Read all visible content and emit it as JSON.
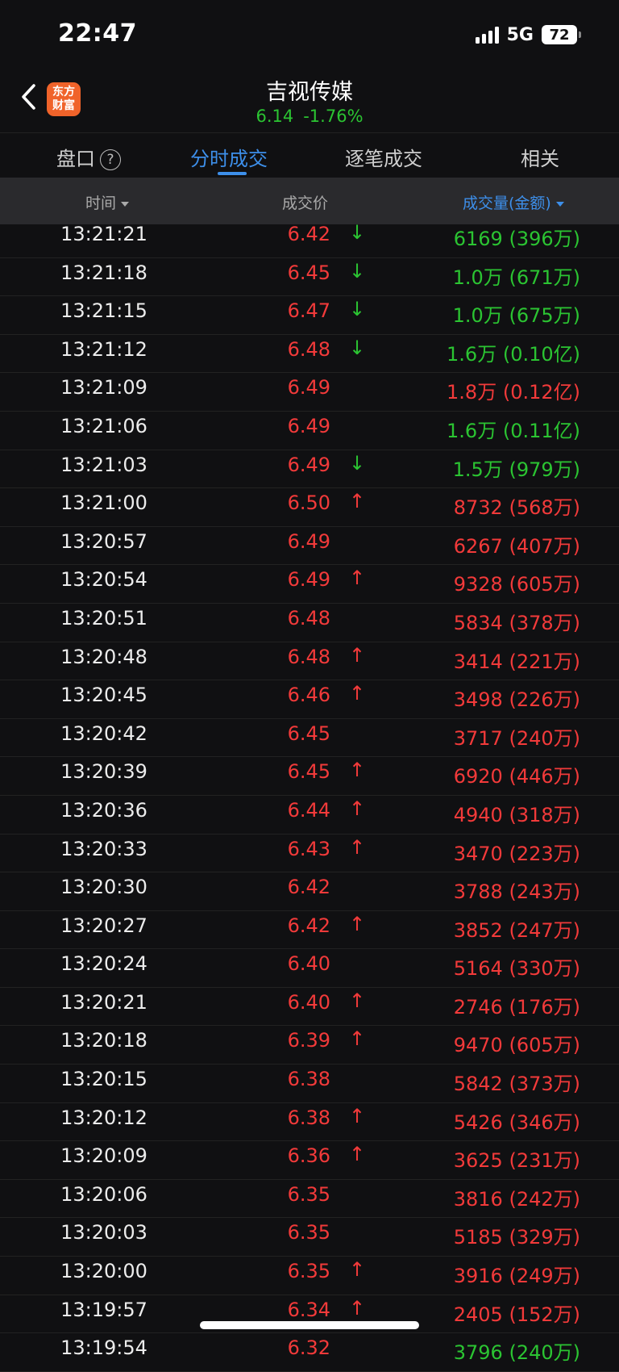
{
  "status_bar": {
    "time": "22:47",
    "network": "5G",
    "battery": "72"
  },
  "nav": {
    "logo_line1": "东方",
    "logo_line2": "财富",
    "stock_name": "吉视传媒",
    "price": "6.14",
    "change_pct": "-1.76%"
  },
  "tabs": [
    "盘口",
    "分时成交",
    "逐笔成交",
    "相关"
  ],
  "active_tab": "分时成交",
  "headers": {
    "time": "时间",
    "price": "成交价",
    "volume": "成交量(金额)"
  },
  "colors": {
    "up": "#f23a3a",
    "down": "#2bc432",
    "accent": "#3d8fea"
  },
  "rows": [
    {
      "time": "13:21:21",
      "price": "6.42",
      "arrow": "↓",
      "volume": "6169 (396万)",
      "vol_color": "green"
    },
    {
      "time": "13:21:18",
      "price": "6.45",
      "arrow": "↓",
      "volume": "1.0万 (671万)",
      "vol_color": "green"
    },
    {
      "time": "13:21:15",
      "price": "6.47",
      "arrow": "↓",
      "volume": "1.0万 (675万)",
      "vol_color": "green"
    },
    {
      "time": "13:21:12",
      "price": "6.48",
      "arrow": "↓",
      "volume": "1.6万 (0.10亿)",
      "vol_color": "green"
    },
    {
      "time": "13:21:09",
      "price": "6.49",
      "arrow": "",
      "volume": "1.8万 (0.12亿)",
      "vol_color": "red"
    },
    {
      "time": "13:21:06",
      "price": "6.49",
      "arrow": "",
      "volume": "1.6万 (0.11亿)",
      "vol_color": "green"
    },
    {
      "time": "13:21:03",
      "price": "6.49",
      "arrow": "↓",
      "volume": "1.5万 (979万)",
      "vol_color": "green"
    },
    {
      "time": "13:21:00",
      "price": "6.50",
      "arrow": "↑",
      "volume": "8732 (568万)",
      "vol_color": "red"
    },
    {
      "time": "13:20:57",
      "price": "6.49",
      "arrow": "",
      "volume": "6267 (407万)",
      "vol_color": "red"
    },
    {
      "time": "13:20:54",
      "price": "6.49",
      "arrow": "↑",
      "volume": "9328 (605万)",
      "vol_color": "red"
    },
    {
      "time": "13:20:51",
      "price": "6.48",
      "arrow": "",
      "volume": "5834 (378万)",
      "vol_color": "red"
    },
    {
      "time": "13:20:48",
      "price": "6.48",
      "arrow": "↑",
      "volume": "3414 (221万)",
      "vol_color": "red"
    },
    {
      "time": "13:20:45",
      "price": "6.46",
      "arrow": "↑",
      "volume": "3498 (226万)",
      "vol_color": "red"
    },
    {
      "time": "13:20:42",
      "price": "6.45",
      "arrow": "",
      "volume": "3717 (240万)",
      "vol_color": "red"
    },
    {
      "time": "13:20:39",
      "price": "6.45",
      "arrow": "↑",
      "volume": "6920 (446万)",
      "vol_color": "red"
    },
    {
      "time": "13:20:36",
      "price": "6.44",
      "arrow": "↑",
      "volume": "4940 (318万)",
      "vol_color": "red"
    },
    {
      "time": "13:20:33",
      "price": "6.43",
      "arrow": "↑",
      "volume": "3470 (223万)",
      "vol_color": "red"
    },
    {
      "time": "13:20:30",
      "price": "6.42",
      "arrow": "",
      "volume": "3788 (243万)",
      "vol_color": "red"
    },
    {
      "time": "13:20:27",
      "price": "6.42",
      "arrow": "↑",
      "volume": "3852 (247万)",
      "vol_color": "red"
    },
    {
      "time": "13:20:24",
      "price": "6.40",
      "arrow": "",
      "volume": "5164 (330万)",
      "vol_color": "red"
    },
    {
      "time": "13:20:21",
      "price": "6.40",
      "arrow": "↑",
      "volume": "2746 (176万)",
      "vol_color": "red"
    },
    {
      "time": "13:20:18",
      "price": "6.39",
      "arrow": "↑",
      "volume": "9470 (605万)",
      "vol_color": "red"
    },
    {
      "time": "13:20:15",
      "price": "6.38",
      "arrow": "",
      "volume": "5842 (373万)",
      "vol_color": "red"
    },
    {
      "time": "13:20:12",
      "price": "6.38",
      "arrow": "↑",
      "volume": "5426 (346万)",
      "vol_color": "red"
    },
    {
      "time": "13:20:09",
      "price": "6.36",
      "arrow": "↑",
      "volume": "3625 (231万)",
      "vol_color": "red"
    },
    {
      "time": "13:20:06",
      "price": "6.35",
      "arrow": "",
      "volume": "3816 (242万)",
      "vol_color": "red"
    },
    {
      "time": "13:20:03",
      "price": "6.35",
      "arrow": "",
      "volume": "5185 (329万)",
      "vol_color": "red"
    },
    {
      "time": "13:20:00",
      "price": "6.35",
      "arrow": "↑",
      "volume": "3916 (249万)",
      "vol_color": "red"
    },
    {
      "time": "13:19:57",
      "price": "6.34",
      "arrow": "↑",
      "volume": "2405 (152万)",
      "vol_color": "red"
    },
    {
      "time": "13:19:54",
      "price": "6.32",
      "arrow": "",
      "volume": "3796 (240万)",
      "vol_color": "green"
    }
  ]
}
